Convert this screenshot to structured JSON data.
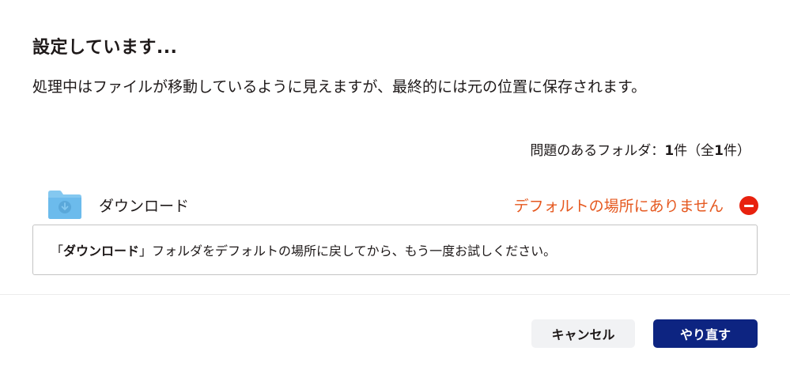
{
  "dialog": {
    "title": "設定しています...",
    "description": "処理中はファイルが移動しているように見えますが、最終的には元の位置に保存されます。",
    "count": {
      "prefix": "問題のあるフォルダ：",
      "current": "1",
      "middle": "件（全",
      "total": "1",
      "suffix": "件）"
    },
    "folder": {
      "icon": "folder-download-icon",
      "name": "ダウンロード",
      "status": "デフォルトの場所にありません",
      "status_color": "#e5581f"
    },
    "message": {
      "open_quote": "「",
      "folder_name": "ダウンロード",
      "close_quote": "」",
      "text": "フォルダをデフォルトの場所に戻してから、もう一度お試しください。"
    },
    "buttons": {
      "cancel": "キャンセル",
      "retry": "やり直す"
    },
    "colors": {
      "primary": "#0d2481",
      "error": "#e8210e",
      "folder": "#7dc4ef"
    }
  }
}
